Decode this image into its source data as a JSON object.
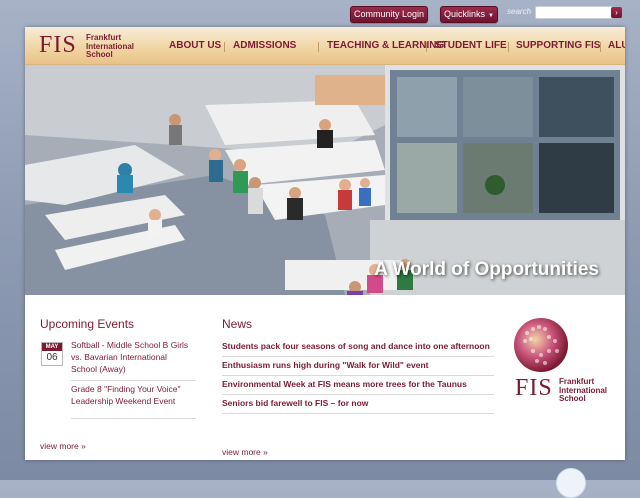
{
  "topbar": {
    "community_login": "Community Login",
    "quicklinks": "Quicklinks",
    "search_label": "search",
    "search_value": ""
  },
  "logo": {
    "mark": "FIS",
    "name": "Frankfurt International School"
  },
  "nav": {
    "items": [
      {
        "label": "ABOUT US"
      },
      {
        "label": "ADMISSIONS"
      },
      {
        "label": "TEACHING & LEARNING"
      },
      {
        "label": "STUDENT LIFE"
      },
      {
        "label": "SUPPORTING FIS"
      },
      {
        "label": "ALUMNI"
      }
    ]
  },
  "hero": {
    "caption": "A World of Opportunities"
  },
  "events": {
    "heading": "Upcoming Events",
    "items": [
      {
        "month": "MAY",
        "day": "06",
        "title": "Softball - Middle School B Girls vs. Bavarian International School (Away)"
      },
      {
        "title": "Grade 8 \"Finding Your Voice\" Leadership Weekend Event"
      }
    ],
    "more": "view more »"
  },
  "news": {
    "heading": "News",
    "items": [
      {
        "title": "Students pack four seasons of song and dance into one afternoon"
      },
      {
        "title": "Enthusiasm runs high during \"Walk for Wild\" event"
      },
      {
        "title": "Environmental Week at FIS means more trees for the Taunus"
      },
      {
        "title": "Seniors bid farewell to FIS – for now"
      }
    ],
    "more": "view more »"
  },
  "side_logo": {
    "mark": "FIS",
    "name": "Frankfurt International School"
  },
  "colors": {
    "brand": "#7d1a33",
    "header_gold": "#f0d6a6",
    "background": "#8f9cb4"
  },
  "icons": {
    "search_go": "chevron-right-icon",
    "quicklinks_caret": "caret-down-icon"
  }
}
